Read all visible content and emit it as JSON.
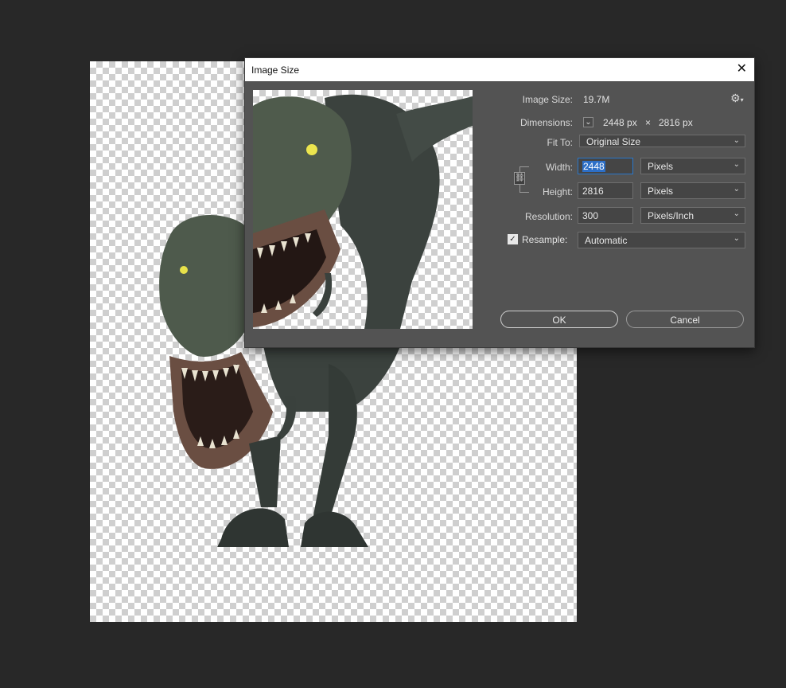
{
  "dialog": {
    "title": "Image Size",
    "image_size_label": "Image Size:",
    "image_size_value": "19.7M",
    "dimensions_label": "Dimensions:",
    "dimensions_width": "2448 px",
    "dimensions_times": "×",
    "dimensions_height": "2816 px",
    "fit_to_label": "Fit To:",
    "fit_to_value": "Original Size",
    "width_label": "Width:",
    "width_value": "2448",
    "width_unit": "Pixels",
    "height_label": "Height:",
    "height_value": "2816",
    "height_unit": "Pixels",
    "resolution_label": "Resolution:",
    "resolution_value": "300",
    "resolution_unit": "Pixels/Inch",
    "resample_label": "Resample:",
    "resample_checked": true,
    "resample_value": "Automatic",
    "ok_label": "OK",
    "cancel_label": "Cancel"
  },
  "icons": {
    "close": "close-icon",
    "gear": "gear-icon",
    "link": "link-icon",
    "check": "checkmark-icon",
    "dropdown": "chevron-down-icon"
  },
  "colors": {
    "app_background": "#282828",
    "dialog_background": "#535353",
    "field_background": "#454545",
    "focus_border": "#2a77c9",
    "selection_highlight": "#2d6fc7"
  }
}
